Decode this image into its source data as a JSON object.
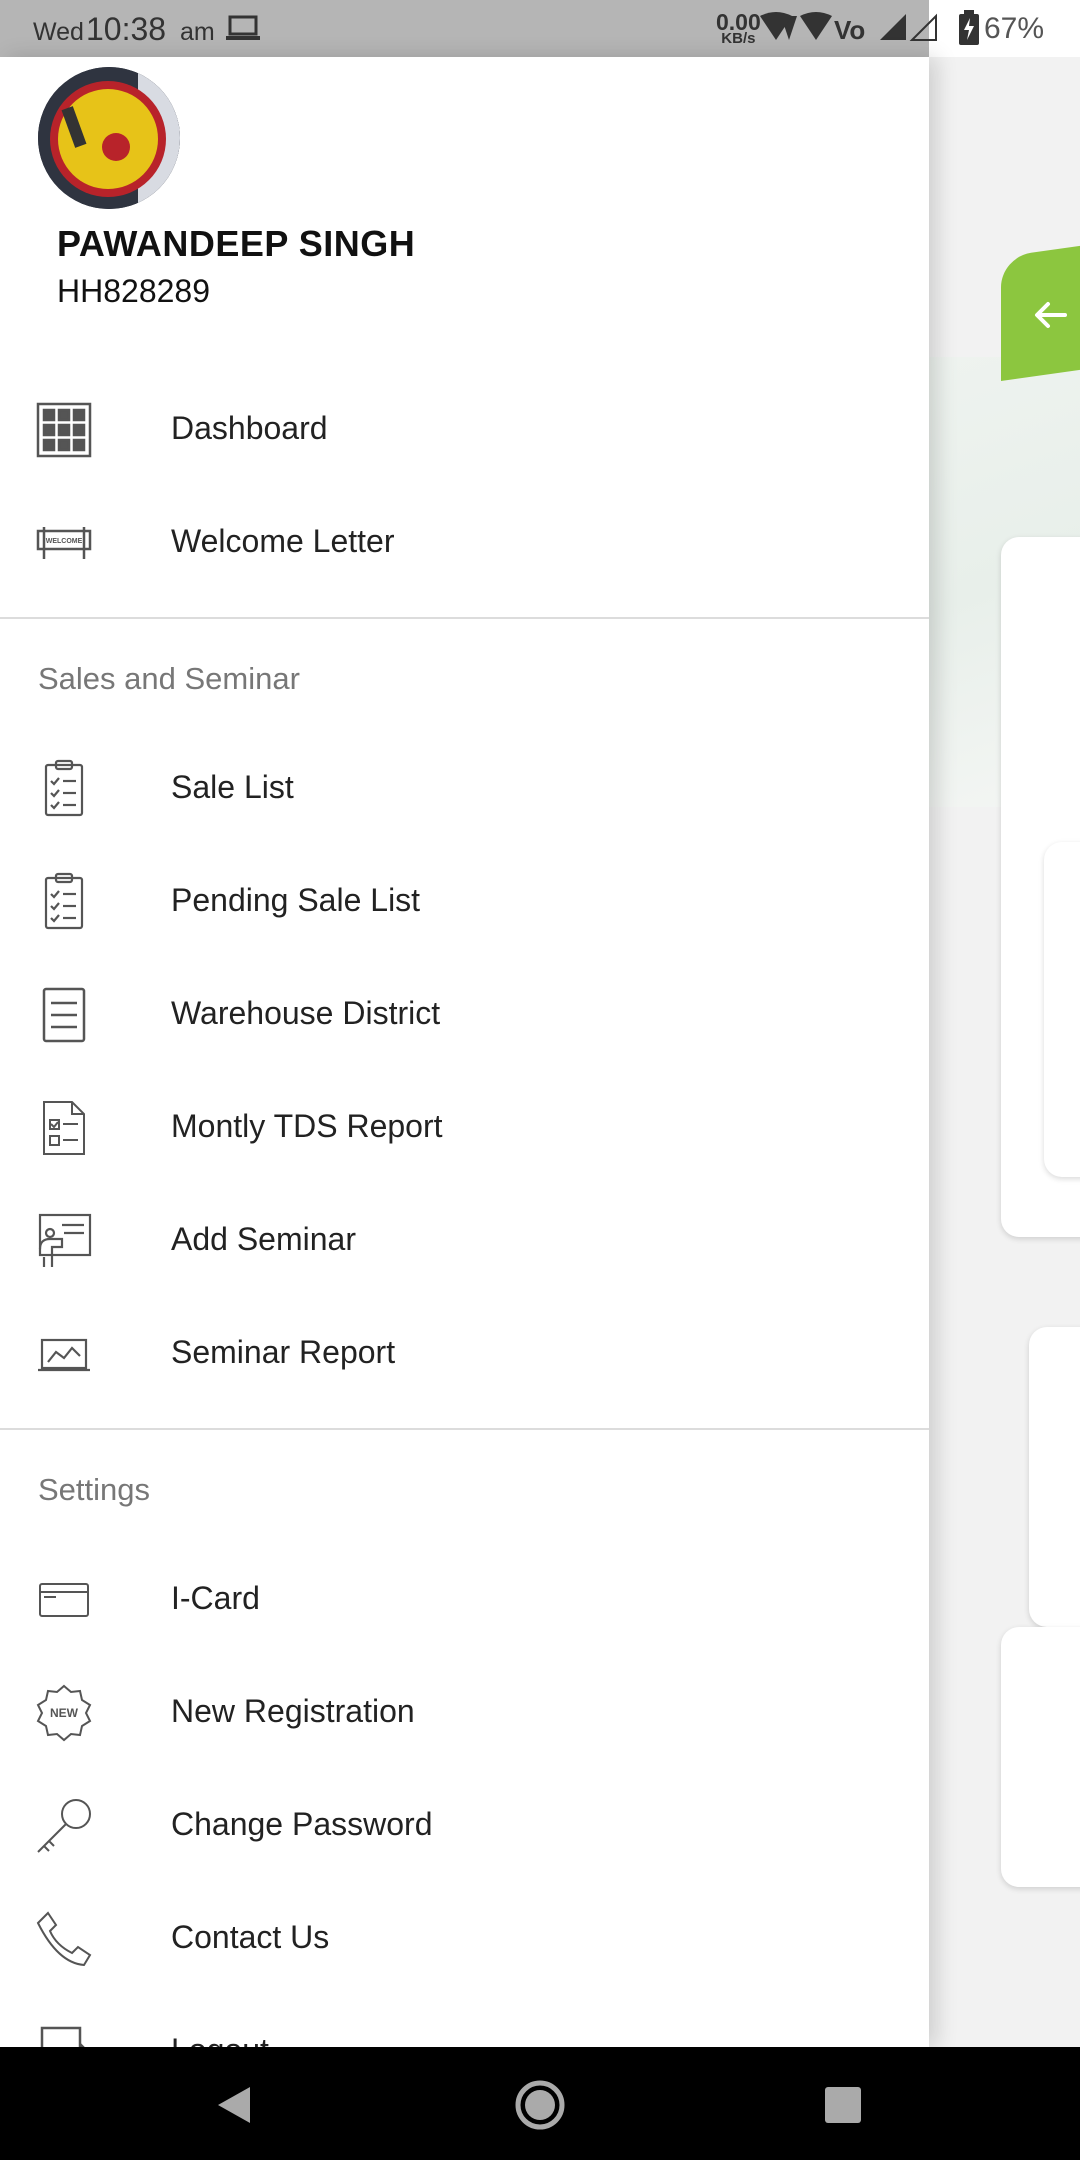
{
  "status_bar": {
    "day": "Wed",
    "time": "10:38",
    "ampm": "am",
    "net_speed": "0.00",
    "net_unit": "KB/s",
    "battery": "67%"
  },
  "user": {
    "name": "PAWANDEEP SINGH",
    "id": "HH828289"
  },
  "menu": {
    "main": [
      {
        "label": "Dashboard",
        "icon": "grid-icon"
      },
      {
        "label": "Welcome Letter",
        "icon": "welcome-sign-icon"
      }
    ],
    "sales_section_title": "Sales and Seminar",
    "sales": [
      {
        "label": "Sale List",
        "icon": "clipboard-checklist-icon"
      },
      {
        "label": "Pending Sale List",
        "icon": "clipboard-checklist-icon"
      },
      {
        "label": "Warehouse District",
        "icon": "document-list-icon"
      },
      {
        "label": "Montly TDS Report",
        "icon": "report-document-icon"
      },
      {
        "label": "Add Seminar",
        "icon": "seminar-board-icon"
      },
      {
        "label": "Seminar Report",
        "icon": "chart-monitor-icon"
      }
    ],
    "settings_section_title": "Settings",
    "settings": [
      {
        "label": "I-Card",
        "icon": "id-card-icon"
      },
      {
        "label": "New Registration",
        "icon": "new-badge-icon"
      },
      {
        "label": "Change Password",
        "icon": "key-icon"
      },
      {
        "label": "Contact Us",
        "icon": "phone-icon"
      },
      {
        "label": "Logout",
        "icon": "logout-icon"
      }
    ]
  },
  "accent_color": "#8cc63f"
}
